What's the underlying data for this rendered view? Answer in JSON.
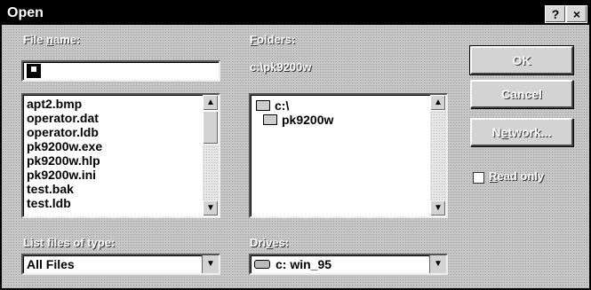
{
  "window": {
    "title": "Open",
    "help_label": "?",
    "close_label": "×"
  },
  "file_name": {
    "label_prefix": "File ",
    "label_accel": "n",
    "label_suffix": "ame:",
    "value": ""
  },
  "files": [
    "apt2.bmp",
    "operator.dat",
    "operator.ldb",
    "pk9200w.exe",
    "pk9200w.hlp",
    "pk9200w.ini",
    "test.bak",
    "test.ldb"
  ],
  "folders": {
    "label_accel": "F",
    "label_suffix": "olders:",
    "path": "c:\\pk9200w",
    "items": [
      "c:\\",
      "pk9200w"
    ]
  },
  "file_type": {
    "label": "List files of type:",
    "value": "All Files"
  },
  "drives": {
    "label_prefix": "Dri",
    "label_accel": "v",
    "label_suffix": "es:",
    "value": "c: win_95"
  },
  "buttons": {
    "ok": "OK",
    "cancel": "Cancel",
    "network_prefix": "N",
    "network_accel": "e",
    "network_suffix": "twork..."
  },
  "read_only": {
    "label_accel": "R",
    "label_suffix": "ead only",
    "checked": false
  }
}
